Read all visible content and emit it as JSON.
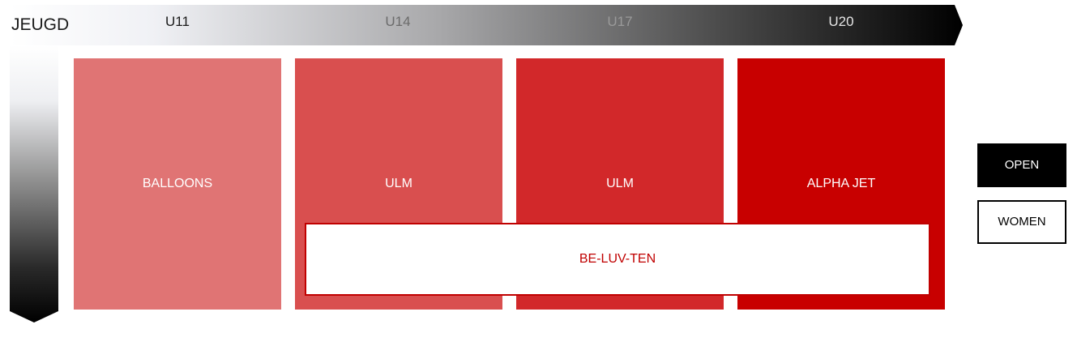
{
  "header": {
    "title": "JEUGD",
    "age_groups": [
      {
        "label": "U11",
        "color": "#1a1a1a"
      },
      {
        "label": "U14",
        "color": "#6b6b6b"
      },
      {
        "label": "U17",
        "color": "#9a9a9a"
      },
      {
        "label": "U20",
        "color": "#e6e6e6"
      }
    ]
  },
  "blocks": [
    {
      "label": "BALLOONS",
      "color": "#e07474"
    },
    {
      "label": "ULM",
      "color": "#d94f4f"
    },
    {
      "label": "ULM",
      "color": "#d2282a"
    },
    {
      "label": "ALPHA JET",
      "color": "#c80000"
    }
  ],
  "overlay": {
    "label": "BE-LUV-TEN",
    "border_color": "#c00000",
    "text_color": "#c00000"
  },
  "legend": {
    "open_label": "OPEN",
    "women_label": "WOMEN"
  }
}
